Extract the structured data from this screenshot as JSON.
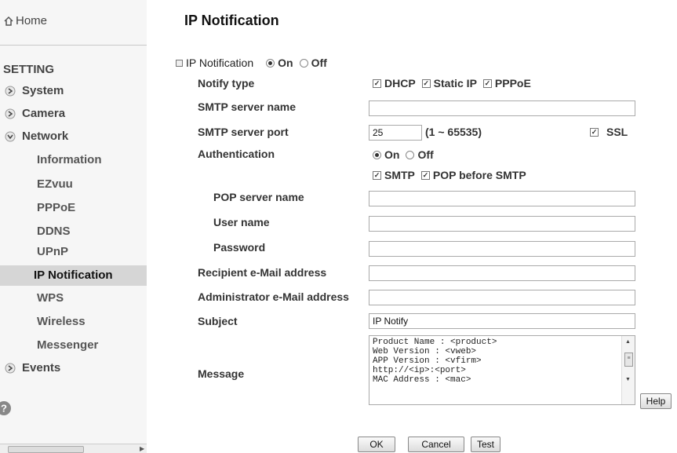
{
  "sidebar": {
    "home": "Home",
    "setting": "SETTING",
    "sections": [
      {
        "label": "System"
      },
      {
        "label": "Camera"
      },
      {
        "label": "Network"
      },
      {
        "label": "Events"
      }
    ],
    "network_items": [
      "Information",
      "EZvuu",
      "PPPoE",
      "DDNS",
      "UPnP",
      "IP Notification",
      "WPS",
      "Wireless",
      "Messenger"
    ],
    "active_item": "IP Notification"
  },
  "main": {
    "title": "IP Notification",
    "ip_notification": {
      "label": "IP Notification",
      "on": "On",
      "off": "Off",
      "selected": "On"
    },
    "notify_type": {
      "label": "Notify type",
      "options": [
        "DHCP",
        "Static IP",
        "PPPoE"
      ]
    },
    "smtp_server_name": {
      "label": "SMTP server name",
      "value": ""
    },
    "smtp_server_port": {
      "label": "SMTP server port",
      "value": "25",
      "range": "(1 ~ 65535)",
      "ssl": "SSL"
    },
    "authentication": {
      "label": "Authentication",
      "on": "On",
      "off": "Off",
      "selected": "On",
      "smtp": "SMTP",
      "pop": "POP before SMTP"
    },
    "pop_server_name": {
      "label": "POP server name",
      "value": ""
    },
    "user_name": {
      "label": "User name",
      "value": ""
    },
    "password": {
      "label": "Password",
      "value": ""
    },
    "recipient": {
      "label": "Recipient e-Mail address",
      "value": ""
    },
    "administrator": {
      "label": "Administrator e-Mail address",
      "value": ""
    },
    "subject": {
      "label": "Subject",
      "value": "IP Notify"
    },
    "message": {
      "label": "Message",
      "value": "Product Name : <product>\nWeb Version : <vweb>\nAPP Version : <vfirm>\nhttp://<ip>:<port>\nMAC Address : <mac>"
    },
    "buttons": {
      "help": "Help",
      "ok": "OK",
      "cancel": "Cancel",
      "test": "Test"
    }
  }
}
